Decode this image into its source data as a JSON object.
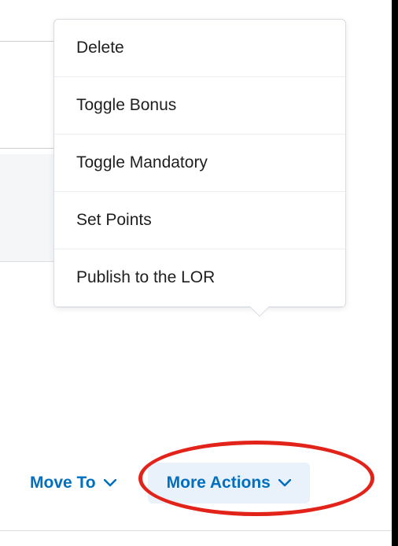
{
  "menu": {
    "items": [
      {
        "label": "Delete"
      },
      {
        "label": "Toggle Bonus"
      },
      {
        "label": "Toggle Mandatory"
      },
      {
        "label": "Set Points"
      },
      {
        "label": "Publish to the LOR"
      }
    ]
  },
  "toolbar": {
    "move_to_label": "Move To",
    "more_actions_label": "More Actions"
  },
  "colors": {
    "link": "#006fbf",
    "highlight": "#e2231a"
  }
}
